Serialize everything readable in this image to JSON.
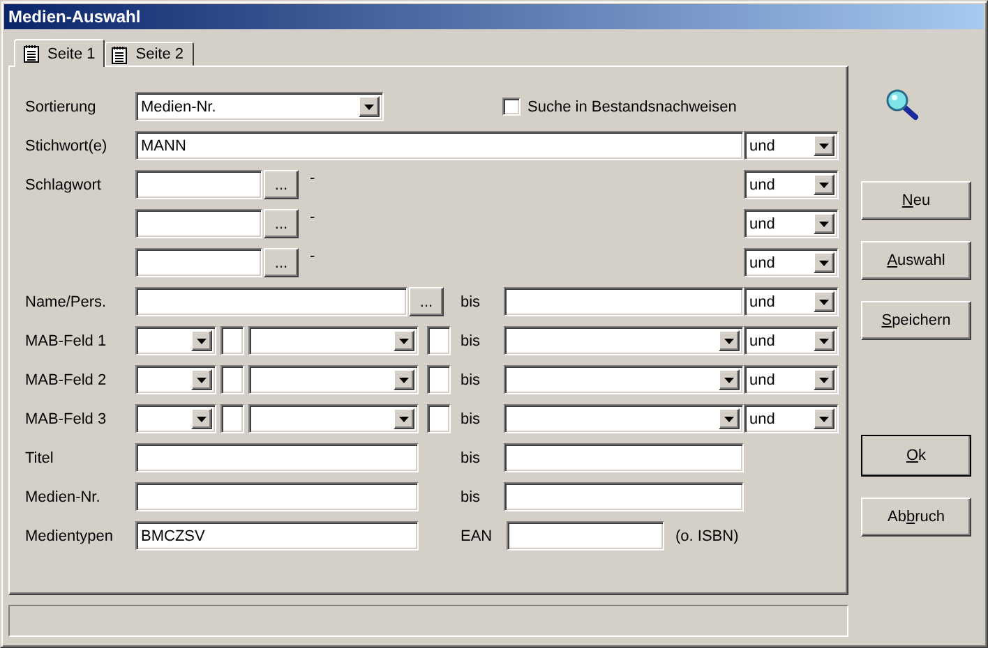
{
  "window": {
    "title": "Medien-Auswahl"
  },
  "tabs": [
    {
      "label": "Seite 1",
      "selected": true
    },
    {
      "label": "Seite 2",
      "selected": false
    }
  ],
  "sort": {
    "label": "Sortierung",
    "value": "Medien-Nr."
  },
  "search_holdings": {
    "label": "Suche in Bestandsnachweisen",
    "checked": false
  },
  "rows": [
    {
      "kind": "keyword",
      "label": "Stichwort(e)",
      "value": "MANN",
      "operator": "und"
    },
    {
      "kind": "lookup",
      "label": "Schlagwort",
      "button": "...",
      "suffix": "-",
      "operator": "und"
    },
    {
      "kind": "lookup",
      "button": "...",
      "suffix": "-",
      "operator": "und"
    },
    {
      "kind": "lookup",
      "button": "...",
      "suffix": "-",
      "operator": "und"
    },
    {
      "kind": "name",
      "label": "Name/Pers.",
      "button": "...",
      "range_label": "bis",
      "operator": "und"
    },
    {
      "kind": "mab",
      "label": "MAB-Feld 1",
      "range_label": "bis",
      "operator": "und"
    },
    {
      "kind": "mab",
      "label": "MAB-Feld 2",
      "range_label": "bis",
      "operator": "und"
    },
    {
      "kind": "mab",
      "label": "MAB-Feld 3",
      "range_label": "bis",
      "operator": "und"
    },
    {
      "kind": "range",
      "label": "Titel",
      "range_label": "bis"
    },
    {
      "kind": "range",
      "label": "Medien-Nr.",
      "range_label": "bis"
    },
    {
      "kind": "types",
      "label": "Medientypen",
      "value": "BMCZSV",
      "extra_label": "EAN",
      "note": "(o. ISBN)"
    }
  ],
  "buttons": [
    {
      "access_key": "N",
      "label_end": "eu",
      "default": false
    },
    {
      "access_key": "A",
      "label_end": "uswahl",
      "default": false
    },
    {
      "access_key": "S",
      "label_end": "peichern",
      "default": false
    },
    {
      "access_key": "O",
      "label_end": "k",
      "default": true
    },
    {
      "label_start": "Ab",
      "access_key": "b",
      "label_end": "ruch",
      "default": false
    }
  ]
}
